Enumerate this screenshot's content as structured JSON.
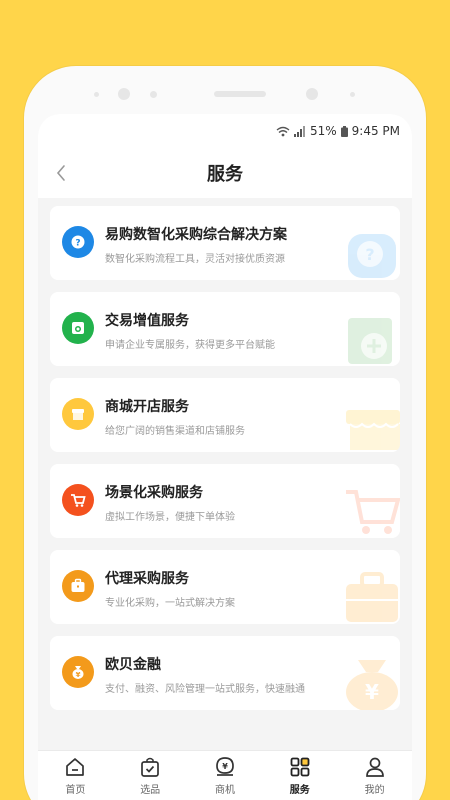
{
  "status": {
    "signal_text": "51%",
    "time": "9:45 PM"
  },
  "header": {
    "title": "服务"
  },
  "services": [
    {
      "title": "易购数智化采购综合解决方案",
      "subtitle": "数智化采购流程工具，灵活对接优质资源",
      "icon": "question-badge-icon",
      "color": "#1E88E5"
    },
    {
      "title": "交易增值服务",
      "subtitle": "申请企业专属服务，获得更多平台赋能",
      "icon": "bag-plus-icon",
      "color": "#22B24C"
    },
    {
      "title": "商城开店服务",
      "subtitle": "给您广阔的销售渠道和店铺服务",
      "icon": "storefront-icon",
      "color": "#FFC83D"
    },
    {
      "title": "场景化采购服务",
      "subtitle": "虚拟工作场景，便捷下单体验",
      "icon": "cart-icon",
      "color": "#F4511E"
    },
    {
      "title": "代理采购服务",
      "subtitle": "专业化采购，一站式解决方案",
      "icon": "briefcase-icon",
      "color": "#F39A1B"
    },
    {
      "title": "欧贝金融",
      "subtitle": "支付、融资、风险管理一站式服务，快速融通",
      "icon": "money-bag-icon",
      "color": "#F39A1B"
    }
  ],
  "tabbar": [
    {
      "label": "首页",
      "icon": "home-icon"
    },
    {
      "label": "选品",
      "icon": "shopping-bag-check-icon"
    },
    {
      "label": "商机",
      "icon": "yen-bubble-icon"
    },
    {
      "label": "服务",
      "icon": "grid-icon"
    },
    {
      "label": "我的",
      "icon": "person-icon"
    }
  ],
  "active_tab": "服务"
}
